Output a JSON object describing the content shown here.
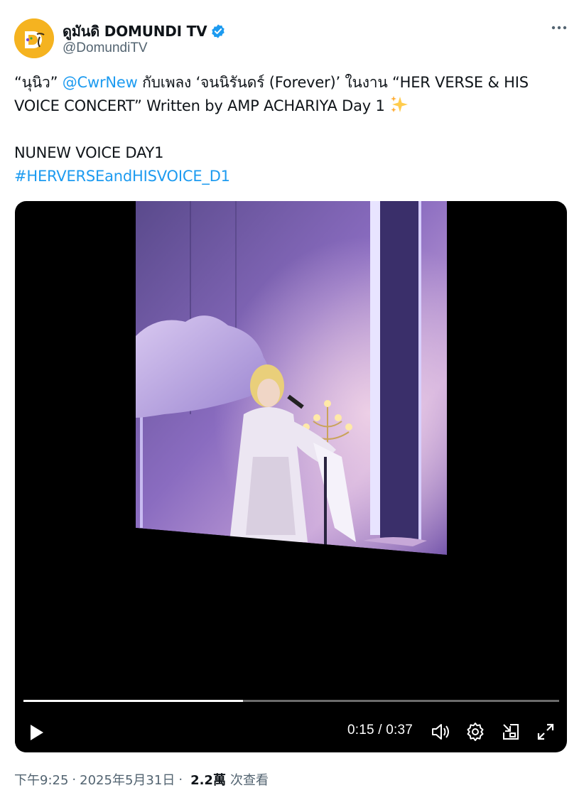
{
  "author": {
    "display_name": "ดูมันดิ DOMUNDI TV",
    "handle": "@DomundiTV",
    "verified": true,
    "avatar_icon": "domundi-logo-icon",
    "avatar_color": "#f5b320"
  },
  "more_icon": "more-horizontal-icon",
  "tweet": {
    "line1_part1": "“นุนิว” ",
    "mention": "@CwrNew",
    "line1_part2": " กับเพลง ‘จนนิรันดร์ (Forever)’ ในงาน “HER VERSE & HIS",
    "line2": "VOICE CONCERT” Written by AMP ACHARIYA Day 1 ",
    "sparkle_icon": "sparkles-icon",
    "line3": "NUNEW VOICE DAY1",
    "hashtag": "#HERVERSEandHISVOICE_D1",
    "link_color": "#1d9bf0"
  },
  "video": {
    "current_time": "0:15",
    "separator": " / ",
    "duration": "0:37",
    "progress_fraction": 0.41,
    "icons": [
      "play-icon",
      "volume-icon",
      "settings-gear-icon",
      "picture-in-picture-icon",
      "fullscreen-icon"
    ]
  },
  "meta": {
    "time": "下午9:25",
    "dot1": "·",
    "date": "2025年5月31日",
    "dot2": "·",
    "views": "2.2萬",
    "views_label": "次查看"
  }
}
